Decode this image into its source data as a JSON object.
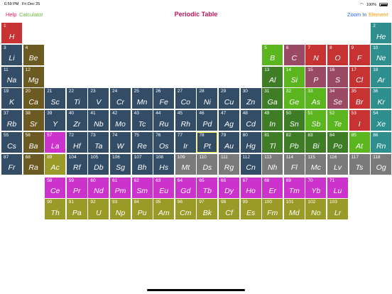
{
  "status_bar": {
    "time": "6:59 PM",
    "date": "Fri Dec 25",
    "battery": "100%",
    "wifi_icon": "wifi-icon"
  },
  "nav": {
    "title": "Periodic Table",
    "help": "Help",
    "calculator": "Calculator",
    "zoom_in": "Zoom In",
    "element": "Element",
    "colors": {
      "title": "#c2185b",
      "help": "#e91e63",
      "calculator": "#66bb33",
      "zoom_in": "#2962ff",
      "element": "#ff9800"
    }
  },
  "colors": {
    "nonmetal": "#5ab51e",
    "noble_gas": "#2f8f8f",
    "alkali": "#c73333",
    "alkaline_earth": "#6b5a22",
    "metalloid": "#3e7c26",
    "halogen": "#9b4a66",
    "transition": "#344d67",
    "post_transition": "#2e6b28",
    "lanthanide": "#cc33cc",
    "actinide": "#9a9a29",
    "unknown": "#7a7a7a"
  },
  "selected_symbol": "Pt",
  "elements": [
    {
      "n": 1,
      "s": "H",
      "r": 1,
      "c": 1,
      "t": "alkali"
    },
    {
      "n": 2,
      "s": "He",
      "r": 1,
      "c": 18,
      "t": "noble_gas"
    },
    {
      "n": 3,
      "s": "Li",
      "r": 2,
      "c": 1,
      "t": "transition"
    },
    {
      "n": 4,
      "s": "Be",
      "r": 2,
      "c": 2,
      "t": "alkaline_earth"
    },
    {
      "n": 5,
      "s": "B",
      "r": 2,
      "c": 13,
      "t": "nonmetal"
    },
    {
      "n": 6,
      "s": "C",
      "r": 2,
      "c": 14,
      "t": "halogen"
    },
    {
      "n": 7,
      "s": "N",
      "r": 2,
      "c": 15,
      "t": "alkali"
    },
    {
      "n": 8,
      "s": "O",
      "r": 2,
      "c": 16,
      "t": "alkali"
    },
    {
      "n": 9,
      "s": "F",
      "r": 2,
      "c": 17,
      "t": "alkali"
    },
    {
      "n": 10,
      "s": "Ne",
      "r": 2,
      "c": 18,
      "t": "noble_gas"
    },
    {
      "n": 11,
      "s": "Na",
      "r": 3,
      "c": 1,
      "t": "transition"
    },
    {
      "n": 12,
      "s": "Mg",
      "r": 3,
      "c": 2,
      "t": "alkaline_earth"
    },
    {
      "n": 13,
      "s": "Al",
      "r": 3,
      "c": 13,
      "t": "metalloid"
    },
    {
      "n": 14,
      "s": "Si",
      "r": 3,
      "c": 14,
      "t": "nonmetal"
    },
    {
      "n": 15,
      "s": "P",
      "r": 3,
      "c": 15,
      "t": "halogen"
    },
    {
      "n": 16,
      "s": "S",
      "r": 3,
      "c": 16,
      "t": "halogen"
    },
    {
      "n": 17,
      "s": "Cl",
      "r": 3,
      "c": 17,
      "t": "alkali"
    },
    {
      "n": 18,
      "s": "Ar",
      "r": 3,
      "c": 18,
      "t": "noble_gas"
    },
    {
      "n": 19,
      "s": "K",
      "r": 4,
      "c": 1,
      "t": "transition"
    },
    {
      "n": 20,
      "s": "Ca",
      "r": 4,
      "c": 2,
      "t": "alkaline_earth"
    },
    {
      "n": 21,
      "s": "Sc",
      "r": 4,
      "c": 3,
      "t": "transition"
    },
    {
      "n": 22,
      "s": "Ti",
      "r": 4,
      "c": 4,
      "t": "transition"
    },
    {
      "n": 23,
      "s": "V",
      "r": 4,
      "c": 5,
      "t": "transition"
    },
    {
      "n": 24,
      "s": "Cr",
      "r": 4,
      "c": 6,
      "t": "transition"
    },
    {
      "n": 25,
      "s": "Mn",
      "r": 4,
      "c": 7,
      "t": "transition"
    },
    {
      "n": 26,
      "s": "Fe",
      "r": 4,
      "c": 8,
      "t": "transition"
    },
    {
      "n": 27,
      "s": "Co",
      "r": 4,
      "c": 9,
      "t": "transition"
    },
    {
      "n": 28,
      "s": "Ni",
      "r": 4,
      "c": 10,
      "t": "transition"
    },
    {
      "n": 29,
      "s": "Cu",
      "r": 4,
      "c": 11,
      "t": "transition"
    },
    {
      "n": 30,
      "s": "Zn",
      "r": 4,
      "c": 12,
      "t": "transition"
    },
    {
      "n": 31,
      "s": "Ga",
      "r": 4,
      "c": 13,
      "t": "metalloid"
    },
    {
      "n": 32,
      "s": "Ge",
      "r": 4,
      "c": 14,
      "t": "nonmetal"
    },
    {
      "n": 33,
      "s": "As",
      "r": 4,
      "c": 15,
      "t": "nonmetal"
    },
    {
      "n": 34,
      "s": "Se",
      "r": 4,
      "c": 16,
      "t": "halogen"
    },
    {
      "n": 35,
      "s": "Br",
      "r": 4,
      "c": 17,
      "t": "alkali"
    },
    {
      "n": 36,
      "s": "Kr",
      "r": 4,
      "c": 18,
      "t": "noble_gas"
    },
    {
      "n": 37,
      "s": "Rb",
      "r": 5,
      "c": 1,
      "t": "transition"
    },
    {
      "n": 38,
      "s": "Sr",
      "r": 5,
      "c": 2,
      "t": "alkaline_earth"
    },
    {
      "n": 39,
      "s": "Y",
      "r": 5,
      "c": 3,
      "t": "transition"
    },
    {
      "n": 40,
      "s": "Zr",
      "r": 5,
      "c": 4,
      "t": "transition"
    },
    {
      "n": 41,
      "s": "Nb",
      "r": 5,
      "c": 5,
      "t": "transition"
    },
    {
      "n": 42,
      "s": "Mo",
      "r": 5,
      "c": 6,
      "t": "transition"
    },
    {
      "n": 43,
      "s": "Tc",
      "r": 5,
      "c": 7,
      "t": "transition"
    },
    {
      "n": 44,
      "s": "Ru",
      "r": 5,
      "c": 8,
      "t": "transition"
    },
    {
      "n": 45,
      "s": "Rh",
      "r": 5,
      "c": 9,
      "t": "transition"
    },
    {
      "n": 46,
      "s": "Pd",
      "r": 5,
      "c": 10,
      "t": "transition"
    },
    {
      "n": 47,
      "s": "Ag",
      "r": 5,
      "c": 11,
      "t": "transition"
    },
    {
      "n": 48,
      "s": "Cd",
      "r": 5,
      "c": 12,
      "t": "transition"
    },
    {
      "n": 49,
      "s": "In",
      "r": 5,
      "c": 13,
      "t": "metalloid"
    },
    {
      "n": 50,
      "s": "Sn",
      "r": 5,
      "c": 14,
      "t": "metalloid"
    },
    {
      "n": 51,
      "s": "Sb",
      "r": 5,
      "c": 15,
      "t": "nonmetal"
    },
    {
      "n": 52,
      "s": "Te",
      "r": 5,
      "c": 16,
      "t": "nonmetal"
    },
    {
      "n": 53,
      "s": "I",
      "r": 5,
      "c": 17,
      "t": "alkali"
    },
    {
      "n": 54,
      "s": "Xe",
      "r": 5,
      "c": 18,
      "t": "noble_gas"
    },
    {
      "n": 55,
      "s": "Cs",
      "r": 6,
      "c": 1,
      "t": "transition"
    },
    {
      "n": 56,
      "s": "Ba",
      "r": 6,
      "c": 2,
      "t": "alkaline_earth"
    },
    {
      "n": 57,
      "s": "La",
      "r": 6,
      "c": 3,
      "t": "lanthanide"
    },
    {
      "n": 72,
      "s": "Hf",
      "r": 6,
      "c": 4,
      "t": "transition"
    },
    {
      "n": 73,
      "s": "Ta",
      "r": 6,
      "c": 5,
      "t": "transition"
    },
    {
      "n": 74,
      "s": "W",
      "r": 6,
      "c": 6,
      "t": "transition"
    },
    {
      "n": 75,
      "s": "Re",
      "r": 6,
      "c": 7,
      "t": "transition"
    },
    {
      "n": 76,
      "s": "Os",
      "r": 6,
      "c": 8,
      "t": "transition"
    },
    {
      "n": 77,
      "s": "Ir",
      "r": 6,
      "c": 9,
      "t": "transition"
    },
    {
      "n": 78,
      "s": "Pt",
      "r": 6,
      "c": 10,
      "t": "transition"
    },
    {
      "n": 79,
      "s": "Au",
      "r": 6,
      "c": 11,
      "t": "transition"
    },
    {
      "n": 80,
      "s": "Hg",
      "r": 6,
      "c": 12,
      "t": "transition"
    },
    {
      "n": 81,
      "s": "Tl",
      "r": 6,
      "c": 13,
      "t": "metalloid"
    },
    {
      "n": 82,
      "s": "Pb",
      "r": 6,
      "c": 14,
      "t": "metalloid"
    },
    {
      "n": 83,
      "s": "Bi",
      "r": 6,
      "c": 15,
      "t": "metalloid"
    },
    {
      "n": 84,
      "s": "Po",
      "r": 6,
      "c": 16,
      "t": "metalloid"
    },
    {
      "n": 85,
      "s": "At",
      "r": 6,
      "c": 17,
      "t": "nonmetal"
    },
    {
      "n": 86,
      "s": "Rn",
      "r": 6,
      "c": 18,
      "t": "noble_gas"
    },
    {
      "n": 87,
      "s": "Fr",
      "r": 7,
      "c": 1,
      "t": "transition"
    },
    {
      "n": 88,
      "s": "Ra",
      "r": 7,
      "c": 2,
      "t": "alkaline_earth"
    },
    {
      "n": 89,
      "s": "Ac",
      "r": 7,
      "c": 3,
      "t": "actinide"
    },
    {
      "n": 104,
      "s": "Rf",
      "r": 7,
      "c": 4,
      "t": "transition"
    },
    {
      "n": 105,
      "s": "Db",
      "r": 7,
      "c": 5,
      "t": "transition"
    },
    {
      "n": 106,
      "s": "Sg",
      "r": 7,
      "c": 6,
      "t": "transition"
    },
    {
      "n": 107,
      "s": "Bh",
      "r": 7,
      "c": 7,
      "t": "transition"
    },
    {
      "n": 108,
      "s": "Hs",
      "r": 7,
      "c": 8,
      "t": "transition"
    },
    {
      "n": 109,
      "s": "Mt",
      "r": 7,
      "c": 9,
      "t": "unknown"
    },
    {
      "n": 110,
      "s": "Ds",
      "r": 7,
      "c": 10,
      "t": "unknown"
    },
    {
      "n": 111,
      "s": "Rg",
      "r": 7,
      "c": 11,
      "t": "unknown"
    },
    {
      "n": 112,
      "s": "Cn",
      "r": 7,
      "c": 12,
      "t": "transition"
    },
    {
      "n": 113,
      "s": "Nh",
      "r": 7,
      "c": 13,
      "t": "unknown"
    },
    {
      "n": 114,
      "s": "Fl",
      "r": 7,
      "c": 14,
      "t": "unknown"
    },
    {
      "n": 115,
      "s": "Mc",
      "r": 7,
      "c": 15,
      "t": "unknown"
    },
    {
      "n": 116,
      "s": "Lv",
      "r": 7,
      "c": 16,
      "t": "unknown"
    },
    {
      "n": 117,
      "s": "Ts",
      "r": 7,
      "c": 17,
      "t": "unknown"
    },
    {
      "n": 118,
      "s": "Og",
      "r": 7,
      "c": 18,
      "t": "unknown"
    },
    {
      "n": 58,
      "s": "Ce",
      "r": 8,
      "c": 3,
      "t": "lanthanide"
    },
    {
      "n": 59,
      "s": "Pr",
      "r": 8,
      "c": 4,
      "t": "lanthanide"
    },
    {
      "n": 60,
      "s": "Nd",
      "r": 8,
      "c": 5,
      "t": "lanthanide"
    },
    {
      "n": 61,
      "s": "Pm",
      "r": 8,
      "c": 6,
      "t": "lanthanide"
    },
    {
      "n": 62,
      "s": "Sm",
      "r": 8,
      "c": 7,
      "t": "lanthanide"
    },
    {
      "n": 63,
      "s": "Eu",
      "r": 8,
      "c": 8,
      "t": "lanthanide"
    },
    {
      "n": 64,
      "s": "Gd",
      "r": 8,
      "c": 9,
      "t": "lanthanide"
    },
    {
      "n": 65,
      "s": "Tb",
      "r": 8,
      "c": 10,
      "t": "lanthanide"
    },
    {
      "n": 66,
      "s": "Dy",
      "r": 8,
      "c": 11,
      "t": "lanthanide"
    },
    {
      "n": 67,
      "s": "Ho",
      "r": 8,
      "c": 12,
      "t": "lanthanide"
    },
    {
      "n": 68,
      "s": "Er",
      "r": 8,
      "c": 13,
      "t": "lanthanide"
    },
    {
      "n": 69,
      "s": "Tm",
      "r": 8,
      "c": 14,
      "t": "lanthanide"
    },
    {
      "n": 70,
      "s": "Yb",
      "r": 8,
      "c": 15,
      "t": "lanthanide"
    },
    {
      "n": 71,
      "s": "Lu",
      "r": 8,
      "c": 16,
      "t": "lanthanide"
    },
    {
      "n": 90,
      "s": "Th",
      "r": 9,
      "c": 3,
      "t": "actinide"
    },
    {
      "n": 91,
      "s": "Pa",
      "r": 9,
      "c": 4,
      "t": "actinide"
    },
    {
      "n": 92,
      "s": "U",
      "r": 9,
      "c": 5,
      "t": "actinide"
    },
    {
      "n": 93,
      "s": "Np",
      "r": 9,
      "c": 6,
      "t": "actinide"
    },
    {
      "n": 94,
      "s": "Pu",
      "r": 9,
      "c": 7,
      "t": "actinide"
    },
    {
      "n": 95,
      "s": "Am",
      "r": 9,
      "c": 8,
      "t": "actinide"
    },
    {
      "n": 96,
      "s": "Cm",
      "r": 9,
      "c": 9,
      "t": "actinide"
    },
    {
      "n": 97,
      "s": "Bk",
      "r": 9,
      "c": 10,
      "t": "actinide"
    },
    {
      "n": 98,
      "s": "Cf",
      "r": 9,
      "c": 11,
      "t": "actinide"
    },
    {
      "n": 99,
      "s": "Es",
      "r": 9,
      "c": 12,
      "t": "actinide"
    },
    {
      "n": 100,
      "s": "Fm",
      "r": 9,
      "c": 13,
      "t": "actinide"
    },
    {
      "n": 101,
      "s": "Md",
      "r": 9,
      "c": 14,
      "t": "actinide"
    },
    {
      "n": 102,
      "s": "No",
      "r": 9,
      "c": 15,
      "t": "actinide"
    },
    {
      "n": 103,
      "s": "Lr",
      "r": 9,
      "c": 16,
      "t": "actinide"
    }
  ]
}
